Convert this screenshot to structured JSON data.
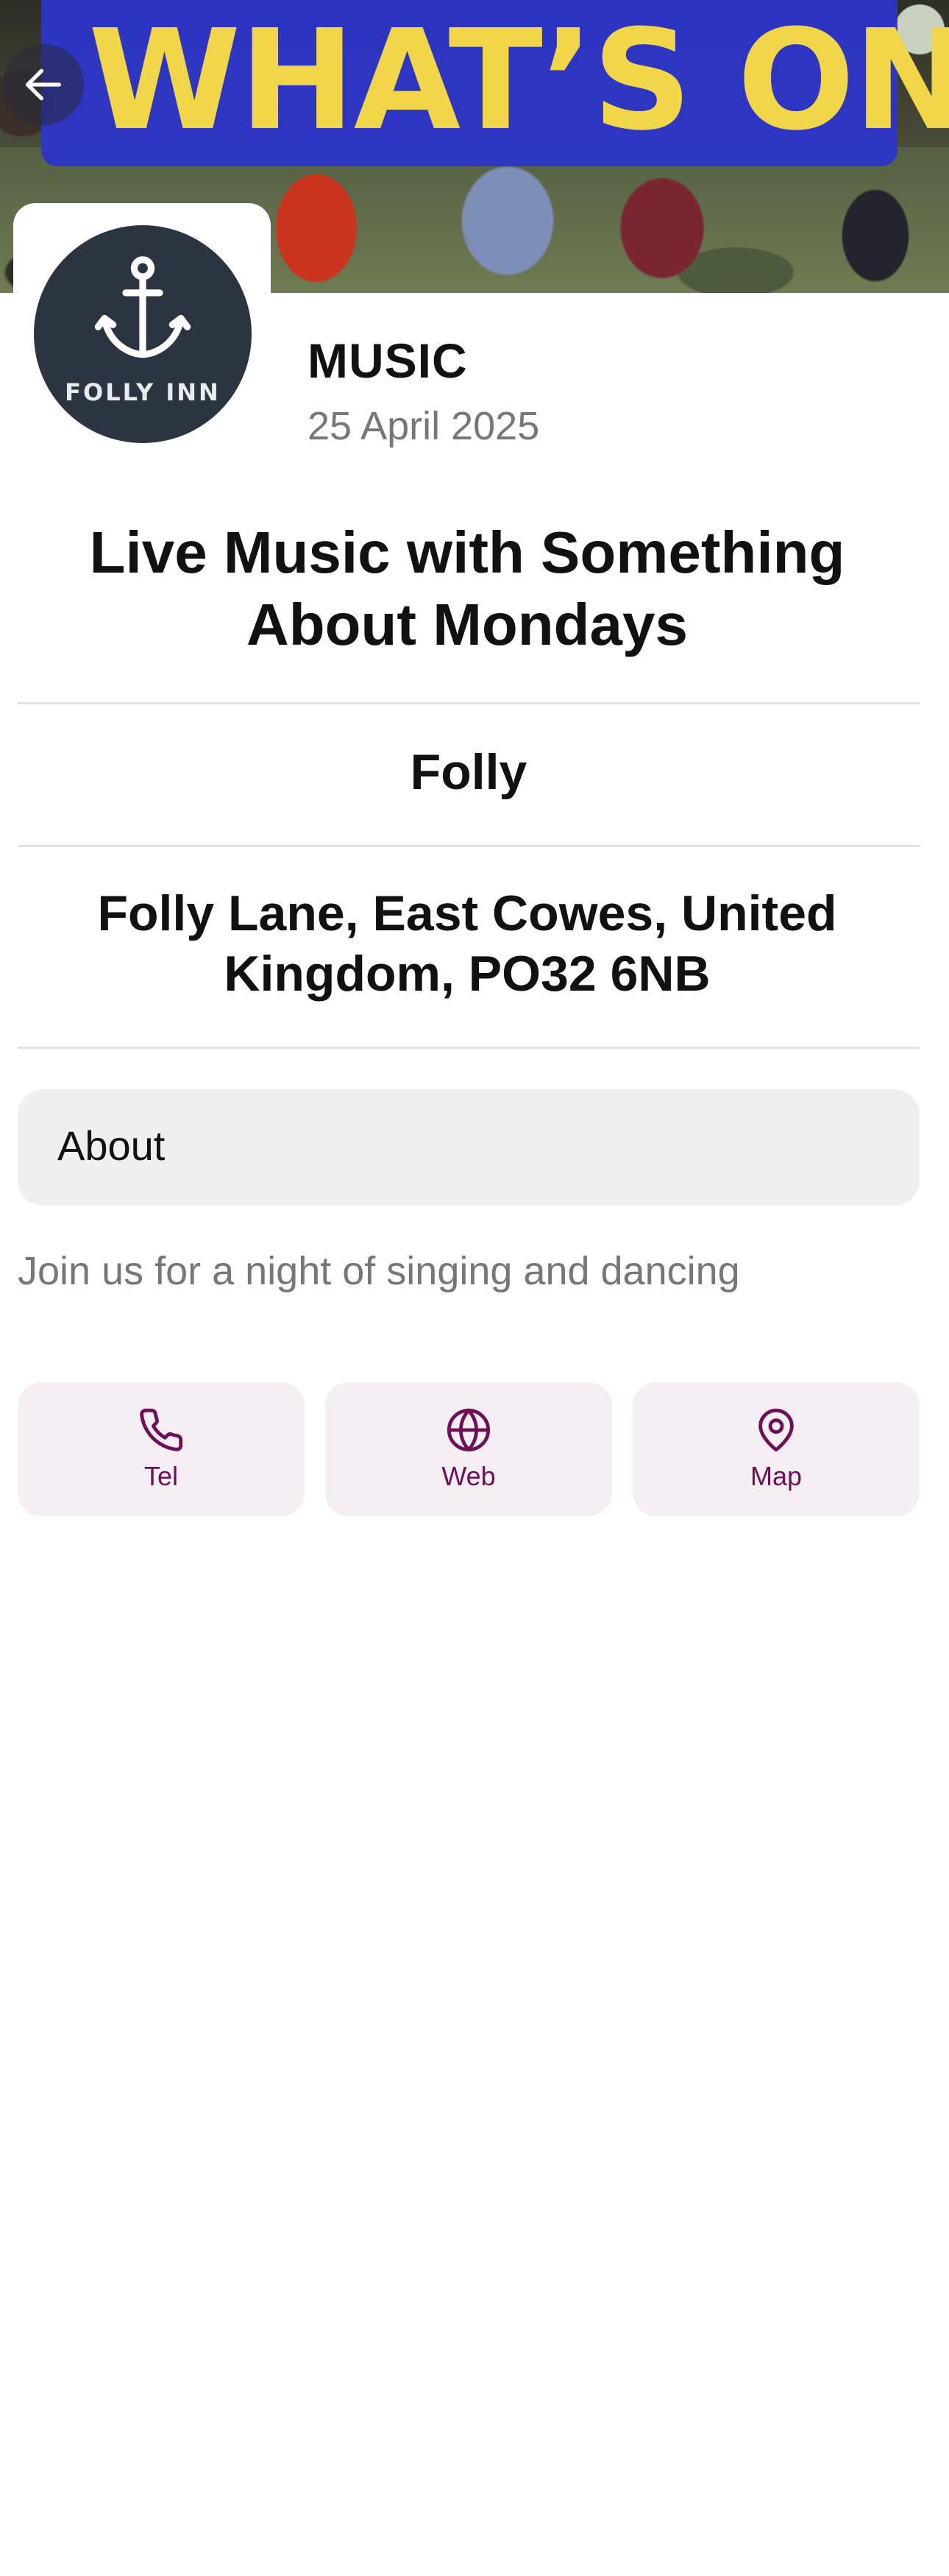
{
  "header": {
    "banner_text": "WHAT’S ON",
    "back_label": "Back"
  },
  "logo": {
    "text": "FOLLY INN"
  },
  "event": {
    "category": "MUSIC",
    "date": "25 April 2025",
    "title": "Live Music with Something About Mondays",
    "venue": "Folly",
    "address": "Folly Lane, East Cowes, United Kingdom, PO32 6NB"
  },
  "about": {
    "label": "About",
    "description": "Join us for a night of singing and dancing"
  },
  "actions": [
    {
      "label": "Tel",
      "icon": "phone-icon"
    },
    {
      "label": "Web",
      "icon": "globe-icon"
    },
    {
      "label": "Map",
      "icon": "map-pin-icon"
    }
  ],
  "colors": {
    "banner_bg": "#2c35c9",
    "banner_text": "#f2d64a",
    "action_bg": "#f5eef2",
    "action_accent": "#6e1057",
    "logo_bg": "#2b3541"
  }
}
